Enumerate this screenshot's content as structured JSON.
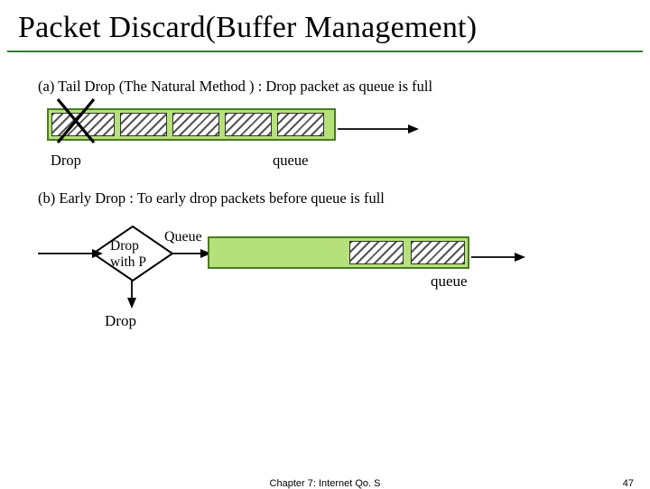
{
  "title": "Packet Discard(Buffer Management)",
  "section_a": {
    "text": "(a) Tail Drop (The Natural Method ) : Drop packet as queue is full",
    "drop_label": "Drop",
    "queue_label": "queue",
    "slots": 5
  },
  "section_b": {
    "text": "(b) Early Drop : To early drop packets before queue is full",
    "diamond_line1": "Drop",
    "diamond_line2": "with P",
    "queue_tag": "Queue",
    "drop_label": "Drop",
    "queue_label": "queue",
    "slots": 2
  },
  "footer": {
    "chapter": "Chapter 7: Internet Qo. S",
    "page": "47"
  }
}
